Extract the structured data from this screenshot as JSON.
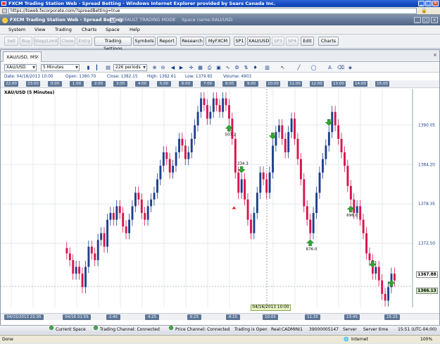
{
  "browser": {
    "title": "FXCM Trading Station Web - Spread Betting - Windows Internet Explorer provided by Sears Canada Inc.",
    "url": "https://tsweb.fxcorporate.com/?spreadBetting=true",
    "status_left": "Done",
    "zone": "Internet",
    "zoom": "100%"
  },
  "app": {
    "title": "FXCM Trading Station Web - Spread Betting",
    "layout": "DEFAULT TRADING MODE",
    "space_name": "Space name:XAU/USD"
  },
  "menu": [
    "System",
    "View",
    "Trading",
    "Charts",
    "Space",
    "Help"
  ],
  "toolbar": {
    "buttons": [
      {
        "label": "Sell",
        "enabled": false
      },
      {
        "label": "Buy",
        "enabled": false
      },
      {
        "label": "Stop/Limit",
        "enabled": false
      },
      {
        "label": "Close",
        "enabled": false
      },
      {
        "label": "Entry",
        "enabled": false
      },
      {
        "label": "Trading Settings",
        "enabled": true
      },
      {
        "label": "Symbols",
        "enabled": true
      },
      {
        "label": "Report",
        "enabled": true
      },
      {
        "label": "Research",
        "enabled": true
      },
      {
        "label": "MyFXCM",
        "enabled": true
      },
      {
        "label": "SP1",
        "enabled": true
      },
      {
        "label": "XAU/USD",
        "enabled": true
      },
      {
        "label": "SP3",
        "enabled": false
      },
      {
        "label": "SP4",
        "enabled": false
      },
      {
        "label": "Edit",
        "enabled": true
      },
      {
        "label": "Charts",
        "enabled": true
      }
    ]
  },
  "chart_tab": {
    "label": "XAU/USD, M5",
    "close": "x"
  },
  "chart_toolbar": {
    "instrument": "XAU/USD",
    "timeframe": "5 Minutes",
    "periods": "226 periods"
  },
  "info": {
    "date": "Date: 04/16/2013 10:00",
    "open": "Open: 1380.70",
    "close": "Close: 1382.15",
    "high": "High: 1382.61",
    "low": "Low: 1379.65",
    "volume": "Volume: 4903"
  },
  "chart_label": "XAU/USD (5 Minutes)",
  "colors": {
    "up": "#1e3f8c",
    "down": "#d8134c",
    "grid": "#e5e8ee",
    "accent": "#5d7697",
    "arrow": "#2fa632"
  },
  "chart_data": {
    "type": "candlestick",
    "x_ticks_top": [
      "22:00",
      "23:00",
      "0:00",
      "1:00",
      "2:00",
      "3:00",
      "4:00",
      "5:00",
      "6:00",
      "7:00",
      "8:00",
      "9:00",
      "10:00",
      "11:00",
      "12:00",
      "13:00",
      "14:00",
      "15:00"
    ],
    "x_ticks_bottom": [
      "04/15/2013 22:05",
      "04/16 01:55",
      "2:45",
      "4:25",
      "6:25",
      "8:15",
      "10:05",
      "11:35",
      "13:45",
      "15:25"
    ],
    "y_ticks": [
      "1390.05",
      "1384.20",
      "1378.35",
      "1372.50"
    ],
    "ylim": [
      1363,
      1395
    ],
    "last_bid": "1367.88",
    "last_ask": "1366.13",
    "crosshair_time": "04/16/2013 10:00",
    "annotations": [
      {
        "label": "507.2",
        "kind": "trade"
      },
      {
        "label": "234.3",
        "kind": "trade"
      },
      {
        "label": "676.0",
        "kind": "trade"
      },
      {
        "label": "696.0",
        "kind": "trade"
      }
    ],
    "close_path": [
      1371,
      1370,
      1368,
      1369,
      1368,
      1366,
      1369,
      1372,
      1371,
      1370,
      1373,
      1374,
      1372,
      1376,
      1377,
      1376,
      1378,
      1377,
      1375,
      1374,
      1376,
      1378,
      1380,
      1379,
      1377,
      1376,
      1378,
      1379,
      1380,
      1382,
      1384,
      1386,
      1385,
      1383,
      1384,
      1386,
      1388,
      1387,
      1385,
      1386,
      1388,
      1390,
      1392,
      1394,
      1393,
      1391,
      1392,
      1394,
      1393,
      1392,
      1394,
      1393,
      1391,
      1388,
      1383,
      1380,
      1382,
      1379,
      1376,
      1374,
      1377,
      1380,
      1383,
      1382,
      1380,
      1383,
      1387,
      1389,
      1390,
      1388,
      1386,
      1389,
      1391,
      1388,
      1385,
      1382,
      1378,
      1376,
      1374,
      1377,
      1380,
      1383,
      1385,
      1387,
      1389,
      1392,
      1390,
      1388,
      1386,
      1384,
      1381,
      1379,
      1377,
      1378,
      1376,
      1374,
      1371,
      1370,
      1368,
      1369,
      1367,
      1365,
      1364,
      1366,
      1368,
      1367
    ]
  },
  "status": {
    "current_space": "Current Space",
    "trading_channel": "Trading Channel: Connected",
    "price_channel": "Price Channel: Connected",
    "trading_open": "Trading is Open",
    "account": "Real:CADMINI1",
    "account_id": "39000005147",
    "server": "Server",
    "server_time": "Server time",
    "clock": "15:51 (UTC-04:00)"
  }
}
